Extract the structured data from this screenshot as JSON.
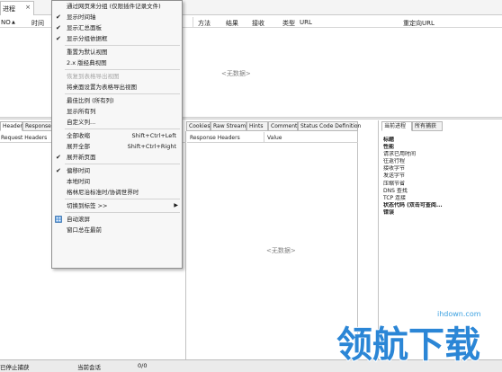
{
  "tab": {
    "title": "进程",
    "close": "×"
  },
  "columns": {
    "no": "NO",
    "time": "时间",
    "method": "方法",
    "result": "结果",
    "received": "接收",
    "type": "类型",
    "url": "URL",
    "redirect_url": "重定向URL",
    "no_sort_arrow": "▲"
  },
  "empty_text": "<无数据>",
  "bottom_tabs_left": [
    "Header",
    "Response"
  ],
  "left_pane": {
    "header": "Request Headers"
  },
  "mid_tabs": [
    "Cookies",
    "Raw Stream",
    "Hints",
    "Comment",
    "Status Code Definition"
  ],
  "mid_pane": {
    "col1": "Response Headers",
    "col2": "Value"
  },
  "right_tabs": [
    "当前进程",
    "所有捕获"
  ],
  "properties": [
    {
      "label": "标题",
      "bold": true
    },
    {
      "label": "性能",
      "bold": true
    },
    {
      "label": "请求已用时间",
      "bold": false
    },
    {
      "label": "往返行程",
      "bold": false
    },
    {
      "label": "接收字节",
      "bold": false
    },
    {
      "label": "发送字节",
      "bold": false
    },
    {
      "label": "压缩节省",
      "bold": false
    },
    {
      "label": "DNS 查找",
      "bold": false
    },
    {
      "label": "TCP 连接",
      "bold": false
    },
    {
      "label": "状态代码 (双击可查阅...",
      "bold": true
    },
    {
      "label": "错误",
      "bold": true
    }
  ],
  "statusbar": {
    "state": "已停止捕获",
    "session": "当前会话",
    "count": "0/0"
  },
  "menu": [
    {
      "kind": "item",
      "label": "通过网页来分组 (仅限插件记录文件)",
      "check": false,
      "disabled": false
    },
    {
      "kind": "item",
      "label": "显示时间轴",
      "check": true,
      "disabled": false
    },
    {
      "kind": "item",
      "label": "显示汇总面板",
      "check": true,
      "disabled": false
    },
    {
      "kind": "item",
      "label": "显示分组依据框",
      "check": true,
      "disabled": false
    },
    {
      "kind": "sep"
    },
    {
      "kind": "item",
      "label": "重置为默认视图",
      "check": false,
      "disabled": false
    },
    {
      "kind": "item",
      "label": "2.x 版经典视图",
      "check": false,
      "disabled": false
    },
    {
      "kind": "sep"
    },
    {
      "kind": "item",
      "label": "恢复到表格导出视图",
      "check": false,
      "disabled": true
    },
    {
      "kind": "item",
      "label": "将桌面设置为表格导出视图",
      "check": false,
      "disabled": false
    },
    {
      "kind": "sep"
    },
    {
      "kind": "item",
      "label": "最佳比例 (所有列)",
      "check": false,
      "disabled": false
    },
    {
      "kind": "item",
      "label": "显示所有列",
      "check": false,
      "disabled": false
    },
    {
      "kind": "item",
      "label": "自定义列...",
      "check": false,
      "disabled": false
    },
    {
      "kind": "sep"
    },
    {
      "kind": "item",
      "label": "全部收缩",
      "shortcut": "Shift+Ctrl+Left",
      "check": false,
      "disabled": false
    },
    {
      "kind": "item",
      "label": "展开全部",
      "shortcut": "Shift+Ctrl+Right",
      "check": false,
      "disabled": false
    },
    {
      "kind": "item",
      "label": "展开新页面",
      "check": true,
      "disabled": false
    },
    {
      "kind": "sep"
    },
    {
      "kind": "item",
      "label": "偏移时间",
      "check": true,
      "disabled": false
    },
    {
      "kind": "item",
      "label": "本地时间",
      "check": false,
      "disabled": false
    },
    {
      "kind": "item",
      "label": "格林尼治标准时/协调世界时",
      "check": false,
      "disabled": false
    },
    {
      "kind": "sep"
    },
    {
      "kind": "item",
      "label": "切换到标签 >>",
      "check": false,
      "disabled": false,
      "submenu": true
    },
    {
      "kind": "sep"
    },
    {
      "kind": "item",
      "label": "自动滚屏",
      "check": false,
      "disabled": false,
      "icon": "autoscroll-icon"
    },
    {
      "kind": "item",
      "label": "窗口总在最前",
      "check": false,
      "disabled": false
    }
  ],
  "watermark": {
    "url": "ihdown.com",
    "brand": "领航下载"
  },
  "colors": {
    "accent": "#2f7fd0",
    "watermark_blue": "#2b86d6"
  }
}
